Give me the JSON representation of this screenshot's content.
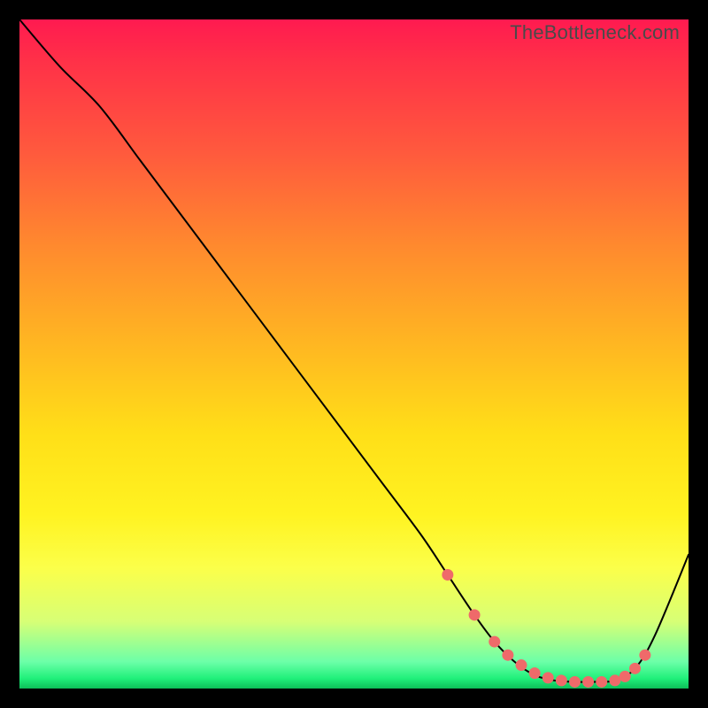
{
  "watermark": "TheBottleneck.com",
  "chart_data": {
    "type": "line",
    "title": "",
    "xlabel": "",
    "ylabel": "",
    "xlim": [
      0,
      100
    ],
    "ylim": [
      0,
      100
    ],
    "series": [
      {
        "name": "curve",
        "x": [
          0,
          6,
          12,
          18,
          24,
          30,
          36,
          42,
          48,
          54,
          60,
          64,
          68,
          71,
          74,
          77,
          80,
          83,
          86,
          89,
          92,
          95,
          100
        ],
        "y": [
          100,
          93,
          87,
          79,
          71,
          63,
          55,
          47,
          39,
          31,
          23,
          17,
          11,
          7,
          4,
          2,
          1.2,
          1.0,
          1.0,
          1.2,
          3,
          8,
          20
        ]
      }
    ],
    "markers": {
      "name": "highlight-dots",
      "x": [
        64,
        68,
        71,
        73,
        75,
        77,
        79,
        81,
        83,
        85,
        87,
        89,
        90.5,
        92,
        93.5
      ],
      "y": [
        17,
        11,
        7,
        5,
        3.5,
        2.3,
        1.6,
        1.2,
        1.0,
        1.0,
        1.0,
        1.2,
        1.8,
        3,
        5
      ]
    },
    "gradient_stops": [
      {
        "pos": 0.0,
        "color": "#ff1a50"
      },
      {
        "pos": 0.2,
        "color": "#ff5a3d"
      },
      {
        "pos": 0.48,
        "color": "#ffdf18"
      },
      {
        "pos": 0.82,
        "color": "#fbff4a"
      },
      {
        "pos": 0.96,
        "color": "#6cffa8"
      },
      {
        "pos": 1.0,
        "color": "#0dbf58"
      }
    ]
  }
}
